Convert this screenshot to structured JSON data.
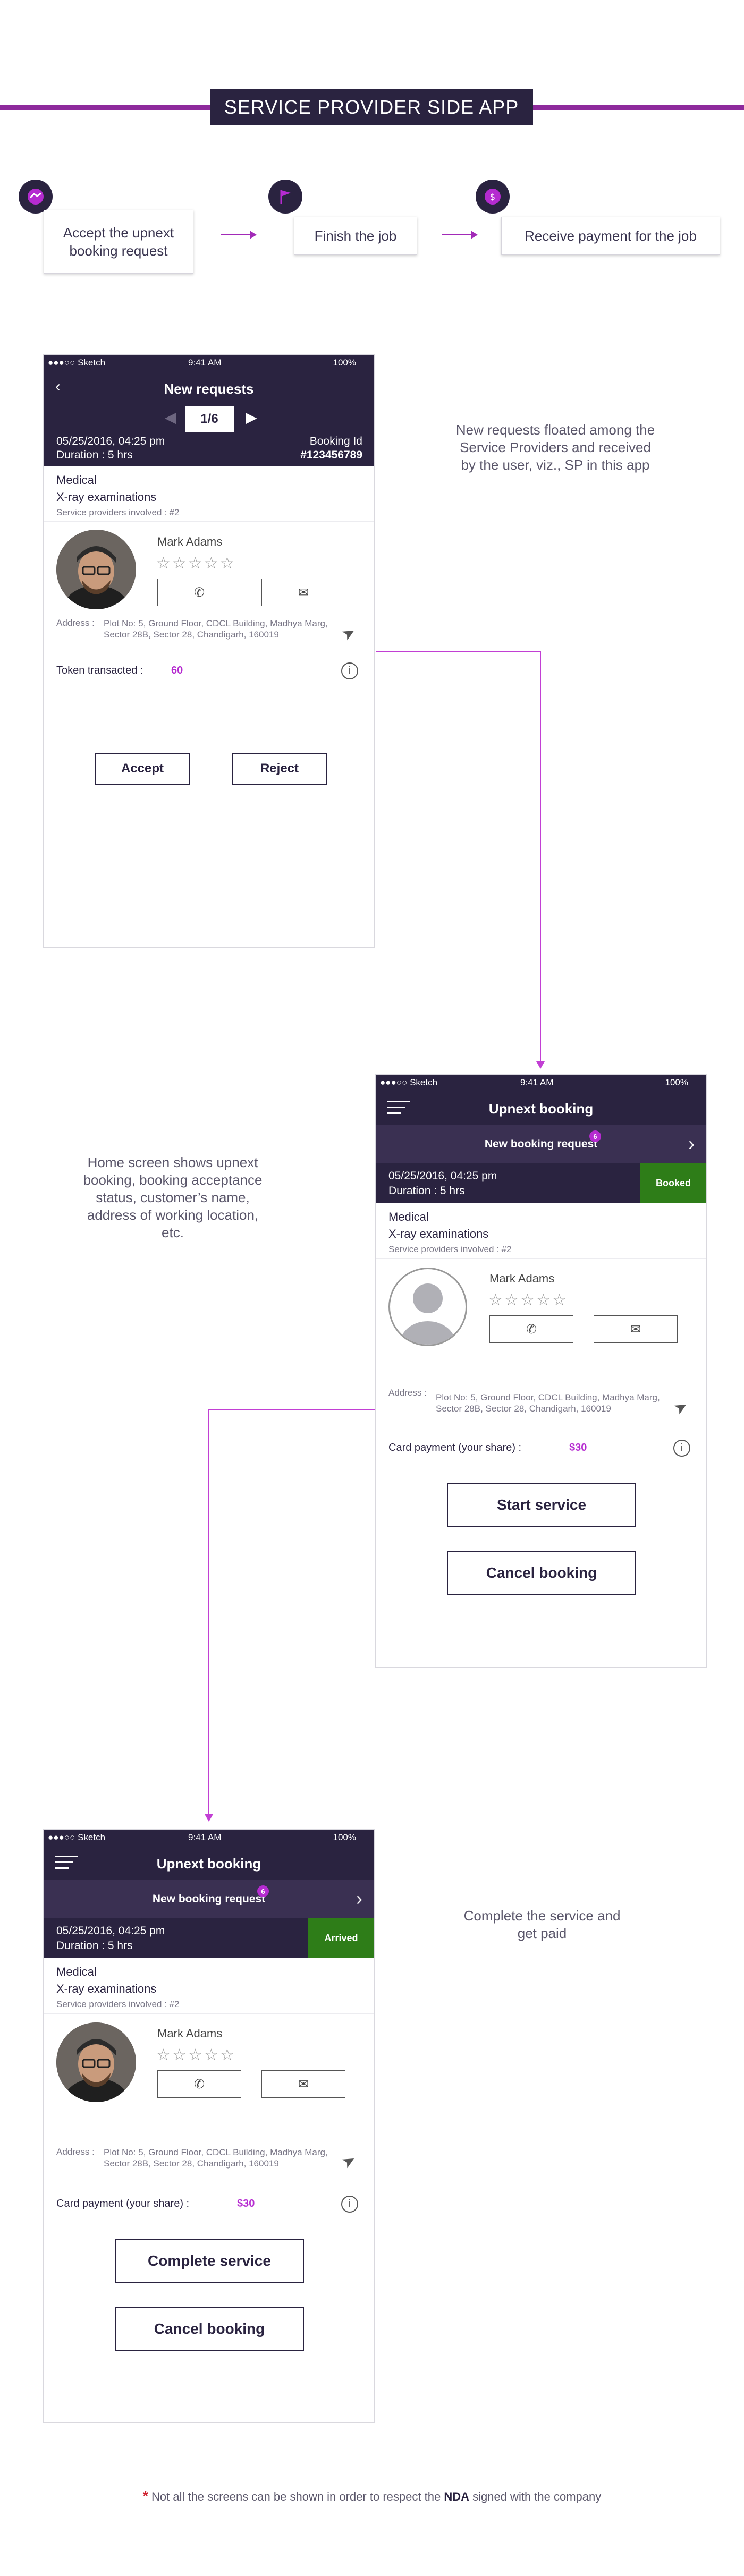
{
  "header": {
    "title": "SERVICE PROVIDER SIDE APP"
  },
  "steps": [
    {
      "label": "Accept the upnext booking request",
      "icon": "handshake-icon"
    },
    {
      "label": "Finish the job",
      "icon": "flag-icon"
    },
    {
      "label": "Receive payment for the job",
      "icon": "payment-hand-icon"
    }
  ],
  "descriptions": {
    "screen1": "New requests floated among the Service Providers and received by the user, viz., SP in this app",
    "screen2": "Home screen shows upnext booking, booking acceptance status, customer’s name, address of working location, etc.",
    "screen3": "Complete the service and get paid"
  },
  "status_bar": {
    "carrier": "●●●○○ Sketch",
    "time": "9:41 AM",
    "battery": "100%"
  },
  "screen1": {
    "title": "New requests",
    "pager": "1/6",
    "date": "05/25/2016, 04:25 pm",
    "duration": "Duration : 5 hrs",
    "booking_id_label": "Booking Id",
    "booking_id": "#123456789",
    "category": "Medical",
    "service": "X-ray examinations",
    "providers": "Service providers involved : #2",
    "customer": "Mark Adams",
    "address_label": "Address :",
    "address": "Plot No: 5, Ground Floor, CDCL Building, Madhya Marg, Sector 28B, Sector 28, Chandigarh, 160019",
    "token_label": "Token transacted :",
    "token_value": "60",
    "accept": "Accept",
    "reject": "Reject"
  },
  "screen2": {
    "title": "Upnext booking",
    "request_label": "New booking request",
    "request_count": "6",
    "date": "05/25/2016, 04:25 pm",
    "duration": "Duration : 5 hrs",
    "status": "Booked",
    "status_color": "#2e7d18",
    "category": "Medical",
    "service": "X-ray examinations",
    "providers": "Service providers involved : #2",
    "customer": "Mark Adams",
    "address_label": "Address :",
    "address": "Plot No: 5, Ground Floor, CDCL Building, Madhya Marg, Sector 28B, Sector 28, Chandigarh, 160019",
    "payment_label": "Card payment (your share) :",
    "payment_value": "$30",
    "primary": "Start service",
    "secondary": "Cancel booking"
  },
  "screen3": {
    "title": "Upnext booking",
    "request_label": "New booking request",
    "request_count": "6",
    "date": "05/25/2016, 04:25 pm",
    "duration": "Duration : 5 hrs",
    "status": "Arrived",
    "status_color": "#2e7d18",
    "category": "Medical",
    "service": "X-ray examinations",
    "providers": "Service providers involved : #2",
    "customer": "Mark Adams",
    "address_label": "Address :",
    "address": "Plot No: 5, Ground Floor, CDCL Building, Madhya Marg, Sector 28B, Sector 28, Chandigarh, 160019",
    "payment_label": "Card payment (your share) :",
    "payment_value": "$30",
    "primary": "Complete service",
    "secondary": "Cancel booking"
  },
  "footer": {
    "asterisk": "*",
    "text_before": "Not all the screens can be shown in order to respect the",
    "bold": "NDA",
    "text_after": "signed with the company"
  },
  "colors": {
    "accent": "#8e2a9c",
    "dark": "#2a2340",
    "link": "#b52bd0",
    "green": "#2e7d18"
  }
}
